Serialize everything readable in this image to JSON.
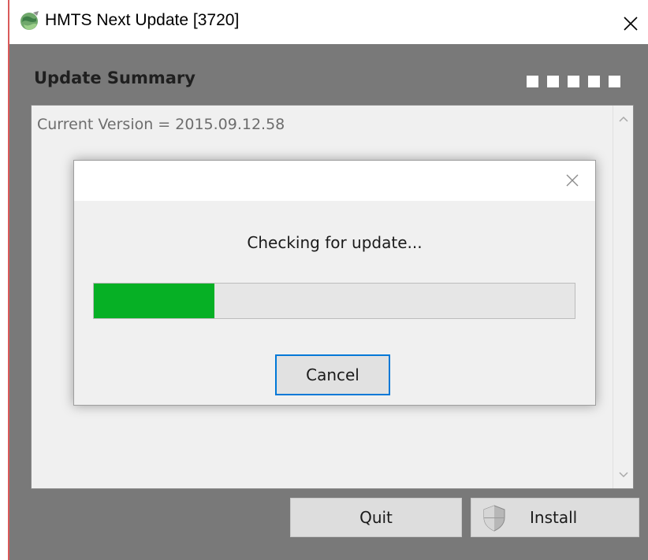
{
  "window": {
    "title": "HMTS Next Update [3720]",
    "icon": "globe-icon",
    "close_icon": "close-icon"
  },
  "summary": {
    "heading": "Update Summary",
    "indicator_count": 5,
    "version_line": "Current Version = 2015.09.12.58"
  },
  "buttons": {
    "quit_label": "Quit",
    "install_label": "Install",
    "install_icon": "shield-icon"
  },
  "dialog": {
    "message": "Checking for update...",
    "progress": 0.25,
    "cancel_label": "Cancel",
    "close_icon": "close-icon"
  },
  "colors": {
    "background": "#797979",
    "progress": "#06b025",
    "focus_border": "#0078d7"
  }
}
